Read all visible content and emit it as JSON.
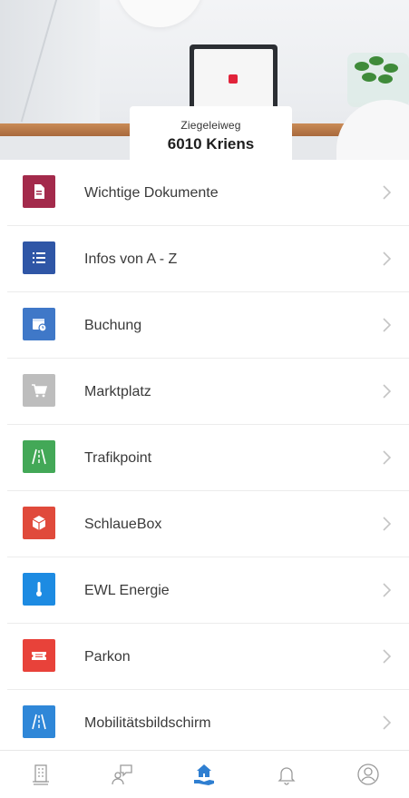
{
  "header": {
    "street": "Ziegeleiweg",
    "city": "6010 Kriens"
  },
  "menu": {
    "items": [
      {
        "label": "Wichtige Dokumente",
        "icon": "document-icon",
        "color": "#a32a4b"
      },
      {
        "label": "Infos von A - Z",
        "icon": "list-icon",
        "color": "#2f56a6"
      },
      {
        "label": "Buchung",
        "icon": "calendar-clock-icon",
        "color": "#3f78c8"
      },
      {
        "label": "Marktplatz",
        "icon": "cart-icon",
        "color": "#bdbdbd"
      },
      {
        "label": "Trafikpoint",
        "icon": "road-icon",
        "color": "#43a857"
      },
      {
        "label": "SchlaueBox",
        "icon": "box-icon",
        "color": "#e04a3b"
      },
      {
        "label": "EWL Energie",
        "icon": "thermometer-icon",
        "color": "#1d8be2"
      },
      {
        "label": "Parkon",
        "icon": "ticket-icon",
        "color": "#e8423a"
      },
      {
        "label": "Mobilitätsbildschirm",
        "icon": "road-icon",
        "color": "#2f87d8"
      }
    ]
  },
  "nav": {
    "items": [
      {
        "icon": "building-icon",
        "active": false
      },
      {
        "icon": "chat-person-icon",
        "active": false
      },
      {
        "icon": "home-hand-icon",
        "active": true
      },
      {
        "icon": "bell-icon",
        "active": false
      },
      {
        "icon": "profile-icon",
        "active": false
      }
    ],
    "active_color": "#2f7fd1",
    "inactive_color": "#9a9a9a"
  }
}
